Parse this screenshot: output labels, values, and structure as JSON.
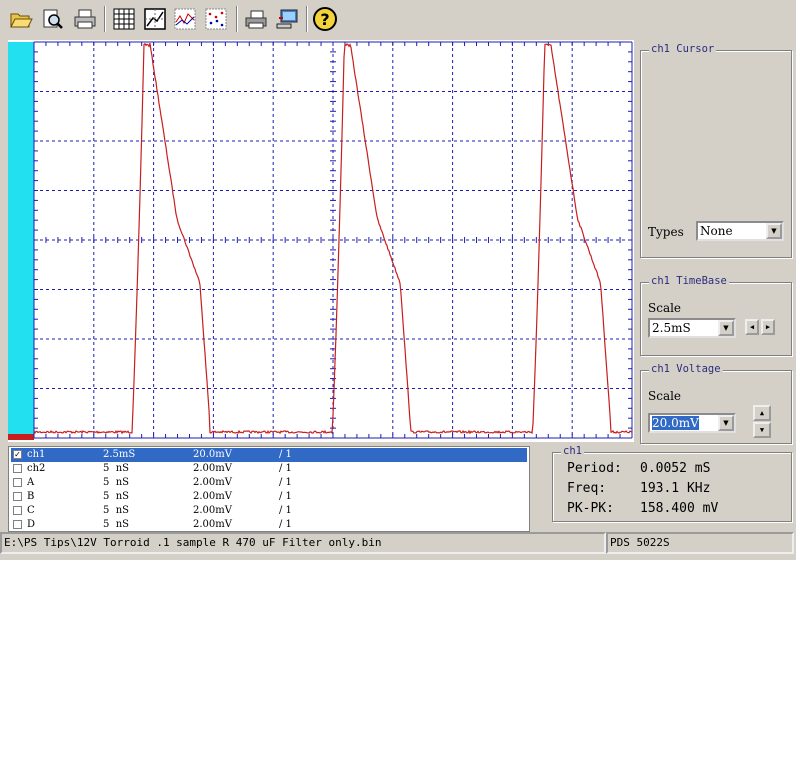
{
  "toolbar": {
    "buttons": [
      {
        "name": "open-icon"
      },
      {
        "name": "zoom-icon"
      },
      {
        "name": "print-icon"
      },
      {
        "name": "calculator-icon"
      },
      {
        "name": "xy-display-icon"
      },
      {
        "name": "waveform-icon"
      },
      {
        "name": "dots-icon"
      },
      {
        "name": "printer-icon"
      },
      {
        "name": "computer-icon"
      },
      {
        "name": "help-icon"
      }
    ]
  },
  "cursor": {
    "title": "ch1 Cursor",
    "types_label": "Types",
    "types_value": "None"
  },
  "timebase": {
    "title": "ch1 TimeBase",
    "scale_label": "Scale",
    "scale_value": "2.5mS"
  },
  "voltage": {
    "title": "ch1 Voltage",
    "scale_label": "Scale",
    "scale_value": "20.0mV"
  },
  "channels": [
    {
      "checked": true,
      "name": "ch1",
      "time": "2.5mS",
      "volt": "20.0mV",
      "div": "/ 1",
      "selected": true
    },
    {
      "checked": false,
      "name": "ch2",
      "time": "5  nS",
      "volt": "2.00mV",
      "div": "/ 1",
      "selected": false
    },
    {
      "checked": false,
      "name": "A",
      "time": "5  nS",
      "volt": "2.00mV",
      "div": "/ 1",
      "selected": false
    },
    {
      "checked": false,
      "name": "B",
      "time": "5  nS",
      "volt": "2.00mV",
      "div": "/ 1",
      "selected": false
    },
    {
      "checked": false,
      "name": "C",
      "time": "5  nS",
      "volt": "2.00mV",
      "div": "/ 1",
      "selected": false
    },
    {
      "checked": false,
      "name": "D",
      "time": "5  nS",
      "volt": "2.00mV",
      "div": "/ 1",
      "selected": false
    }
  ],
  "measure": {
    "title": "ch1",
    "period_label": "Period:",
    "period_value": "0.0052 mS",
    "freq_label": "Freq:",
    "freq_value": "193.1 KHz",
    "pkpk_label": "PK-PK:",
    "pkpk_value": "158.400 mV"
  },
  "status": {
    "file": "E:\\PS Tips\\12V Torroid .1 sample R 470 uF Filter only.bin",
    "device": "PDS 5022S"
  },
  "colors": {
    "trace": "#c81e1e",
    "grid": "#1c1cb4",
    "marker": "#22e0f0",
    "selection": "#316ac5"
  },
  "scope": {
    "pulse_periods_div": 3.35,
    "pulse_count": 3
  }
}
